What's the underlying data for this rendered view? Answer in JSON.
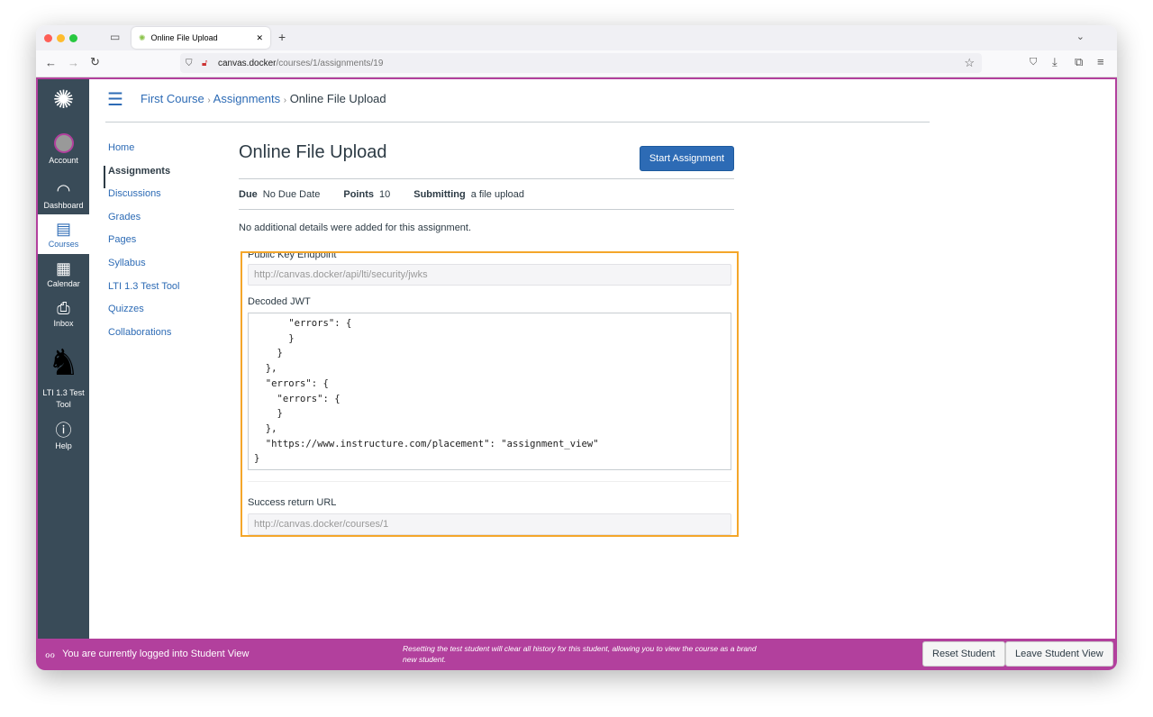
{
  "browser": {
    "tab_title": "Online File Upload",
    "url_host": "canvas.docker",
    "url_path": "/courses/1/assignments/19"
  },
  "global_nav": [
    {
      "label": "Account",
      "icon": "avatar-icon"
    },
    {
      "label": "Dashboard",
      "icon": "speedometer-icon"
    },
    {
      "label": "Courses",
      "icon": "book-icon"
    },
    {
      "label": "Calendar",
      "icon": "calendar-icon"
    },
    {
      "label": "Inbox",
      "icon": "inbox-icon"
    },
    {
      "label": "LTI 1.3 Test Tool",
      "icon": "unicorn-icon"
    },
    {
      "label": "Help",
      "icon": "help-icon"
    }
  ],
  "breadcrumb": [
    "First Course",
    "Assignments",
    "Online File Upload"
  ],
  "course_nav": [
    "Home",
    "Assignments",
    "Discussions",
    "Grades",
    "Pages",
    "Syllabus",
    "LTI 1.3 Test Tool",
    "Quizzes",
    "Collaborations"
  ],
  "assignment": {
    "title": "Online File Upload",
    "start_label": "Start Assignment",
    "due_label": "Due",
    "due": "No Due Date",
    "points_label": "Points",
    "points": "10",
    "submitting_label": "Submitting",
    "submitting": "a file upload",
    "details": "No additional details were added for this assignment."
  },
  "tool": {
    "pk_label": "Public Key Endpoint",
    "pk_value": "http://canvas.docker/api/lti/security/jwks",
    "jwt_label": "Decoded JWT",
    "jwt": "      \"errors\": {\n      }\n    }\n  },\n  \"errors\": {\n    \"errors\": {\n    }\n  },\n  \"https://www.instructure.com/placement\": \"assignment_view\"\n}",
    "return_label": "Success return URL",
    "return_value": "http://canvas.docker/courses/1"
  },
  "footer": {
    "message": "You are currently logged into Student View",
    "note": "Resetting the test student will clear all history for this student, allowing you to view the course as a brand new student.",
    "reset": "Reset Student",
    "leave": "Leave Student View"
  },
  "colors": {
    "brand": "#2d6bb5",
    "student_view": "#b2409d",
    "nav_bg": "#394b58",
    "highlight": "#f4a62a"
  }
}
